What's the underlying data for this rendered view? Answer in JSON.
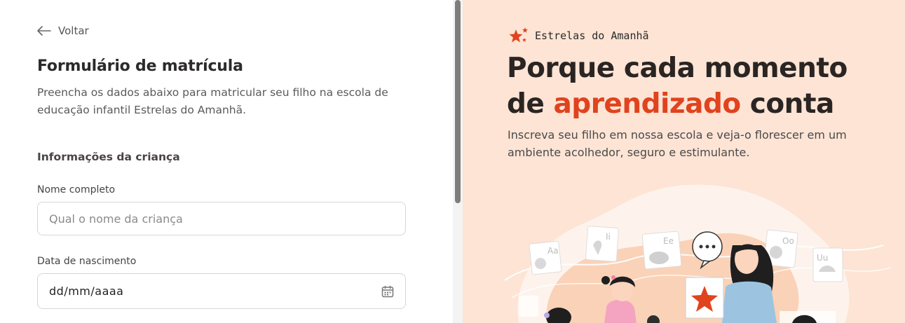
{
  "form": {
    "back_label": "Voltar",
    "title": "Formulário de matrícula",
    "description": "Preencha os dados abaixo para matricular seu filho na escola de educação infantil Estrelas do Amanhã.",
    "section_title": "Informações da criança",
    "name_label": "Nome completo",
    "name_placeholder": "Qual o nome da criança",
    "name_value": "",
    "birth_label": "Data de nascimento",
    "birth_value": "dd/mm/aaaa"
  },
  "hero": {
    "brand": "Estrelas do Amanhã",
    "headline_1": "Porque cada momento",
    "headline_2_pre": "de ",
    "headline_2_highlight": "aprendizado",
    "headline_2_post": " conta",
    "subtitle": "Inscreva seu filho em nossa escola e veja-o florescer em um ambiente acolhedor, seguro e estimulante.",
    "card_letters": [
      "Aa",
      "Ii",
      "Ee",
      "Oo",
      "Uu"
    ],
    "accent_color": "#e0431d",
    "background_color": "#fde4d5"
  },
  "icons": {
    "back": "arrow-left-icon",
    "brand": "stars-logo-icon",
    "date": "calendar-icon"
  }
}
